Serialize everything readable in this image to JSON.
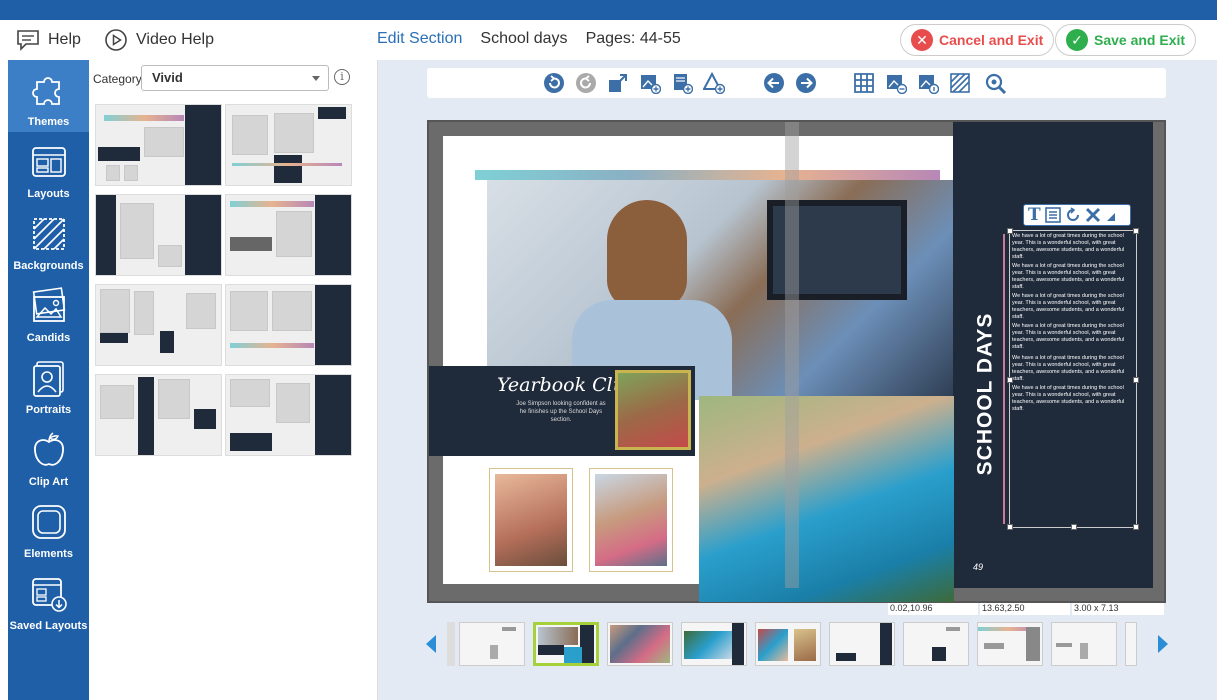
{
  "header": {
    "help_label": "Help",
    "video_help_label": "Video Help",
    "edit_section_label": "Edit Section",
    "section_name": "School days",
    "pages_label": "Pages: 44-55",
    "cancel_label": "Cancel and Exit",
    "save_label": "Save and Exit"
  },
  "sidebar": {
    "items": [
      {
        "label": "Themes",
        "icon": "puzzle-icon"
      },
      {
        "label": "Layouts",
        "icon": "layouts-icon"
      },
      {
        "label": "Backgrounds",
        "icon": "backgrounds-icon"
      },
      {
        "label": "Candids",
        "icon": "candids-icon"
      },
      {
        "label": "Portraits",
        "icon": "portraits-icon"
      },
      {
        "label": "Clip Art",
        "icon": "apple-icon"
      },
      {
        "label": "Elements",
        "icon": "elements-icon"
      },
      {
        "label": "Saved Layouts",
        "icon": "saved-layouts-icon"
      }
    ]
  },
  "panel": {
    "category_label": "Category:",
    "category_value": "Vivid"
  },
  "canvas": {
    "club_title": "Yearbook Club",
    "club_caption": "Joe Simpson looking confident as he finishes up the School Days section.",
    "section_title": "SCHOOL DAYS",
    "body_text": "We have a lot of great times during the school year. This is a wonderful school, with great teachers, awesome students, and a wonderful staff.",
    "page_badge": "49"
  },
  "status": {
    "pos1": "0.02,10.96",
    "pos2": "13.63,2.50",
    "size": "3.00 x 7.13"
  },
  "colors": {
    "brand_blue": "#1e5fa8",
    "navy": "#1f2a3a",
    "accent_green": "#a6d13a",
    "cancel_red": "#e84d4d",
    "save_green": "#2fae4e"
  }
}
